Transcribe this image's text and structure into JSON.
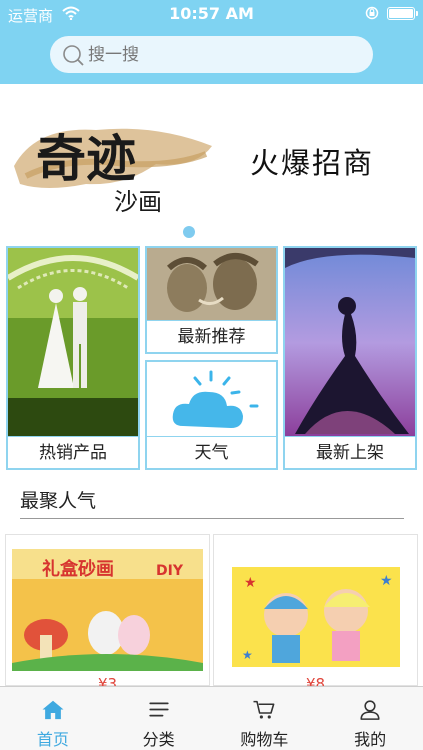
{
  "status_bar": {
    "carrier": "运营商",
    "time": "10:57 AM"
  },
  "search": {
    "placeholder": "搜一搜"
  },
  "banner": {
    "logo_text_main": "奇迹",
    "logo_text_sub": "沙画",
    "slogan": "火爆招商",
    "page_count": 1,
    "active_page": 1
  },
  "categories": {
    "hot": "热销产品",
    "new": "最新推荐",
    "weather": "天气",
    "latest": "最新上架"
  },
  "popular": {
    "title": "最聚人气",
    "products": [
      {
        "art_text": "礼盒砂画",
        "art_badge": "DIY",
        "price": "¥3"
      },
      {
        "price": "¥8"
      }
    ]
  },
  "tabbar": {
    "items": [
      {
        "label": "首页",
        "icon": "home-icon",
        "active": true
      },
      {
        "label": "分类",
        "icon": "list-icon",
        "active": false
      },
      {
        "label": "购物车",
        "icon": "cart-icon",
        "active": false
      },
      {
        "label": "我的",
        "icon": "user-icon",
        "active": false
      }
    ]
  },
  "colors": {
    "header": "#7fd3f2",
    "accent": "#3fa9e0",
    "price": "#e0463c",
    "tile_border": "#8fd4ef"
  }
}
